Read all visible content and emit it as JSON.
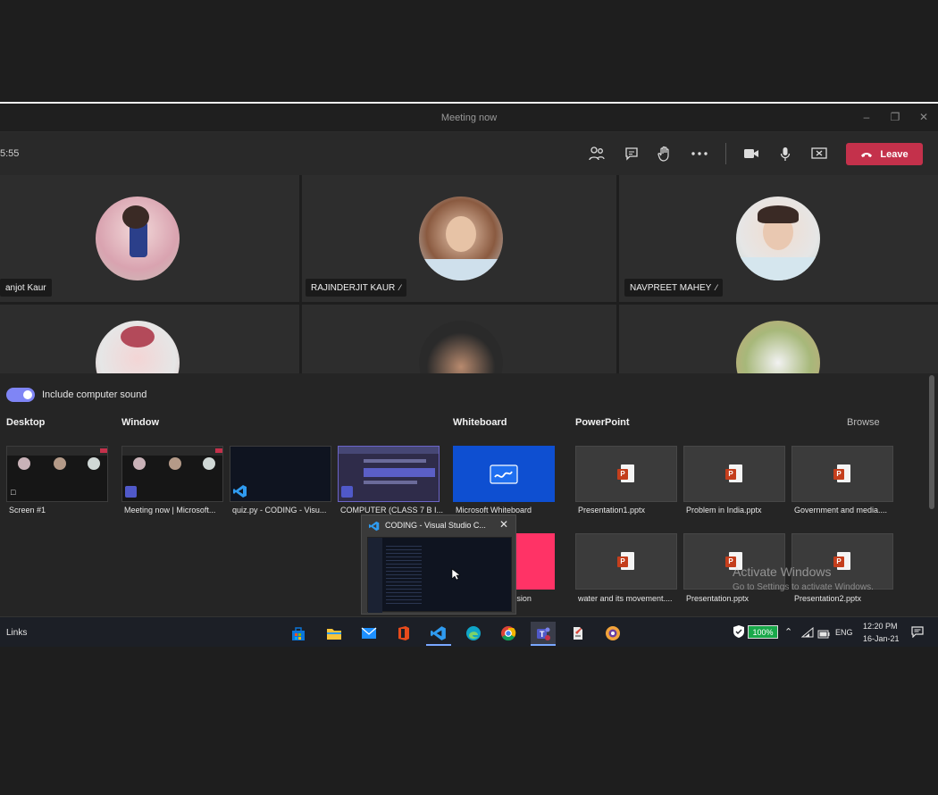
{
  "window": {
    "title": "Meeting now"
  },
  "meeting": {
    "timer": "5:55",
    "leave_label": "Leave"
  },
  "participants": [
    {
      "name": "anjot Kaur",
      "muted": false
    },
    {
      "name": "RAJINDERJIT KAUR",
      "muted": true
    },
    {
      "name": "NAVPREET MAHEY",
      "muted": true
    },
    {
      "name": "",
      "muted": false
    },
    {
      "name": "",
      "muted": false
    },
    {
      "name": "",
      "muted": false
    }
  ],
  "share": {
    "include_sound_label": "Include computer sound",
    "include_sound_on": true,
    "sections": {
      "desktop": "Desktop",
      "window": "Window",
      "whiteboard": "Whiteboard",
      "powerpoint": "PowerPoint",
      "browse": "Browse"
    },
    "desktop_items": [
      "Screen #1"
    ],
    "window_items": [
      "Meeting now | Microsoft...",
      "quiz.py - CODING - Visu...",
      "COMPUTER (CLASS 7 B I..."
    ],
    "whiteboard_items": [
      "Microsoft Whiteboard",
      "Freehand by InVision"
    ],
    "powerpoint_items": [
      "Presentation1.pptx",
      "Problem in India.pptx",
      "Government and media....",
      "water and its movement....",
      "Presentation.pptx",
      "Presentation2.pptx"
    ]
  },
  "popup": {
    "title": "CODING - Visual Studio C..."
  },
  "watermark": {
    "line1": "Activate Windows",
    "line2": "Go to Settings to activate Windows."
  },
  "taskbar": {
    "links_label": "Links",
    "battery": "100%",
    "language": "ENG",
    "time": "12:20 PM",
    "date": "16-Jan-21"
  },
  "colors": {
    "leave": "#c4314b",
    "accent": "#7f85f5",
    "whiteboard": "#0e4fd1",
    "invision": "#ff3366"
  }
}
